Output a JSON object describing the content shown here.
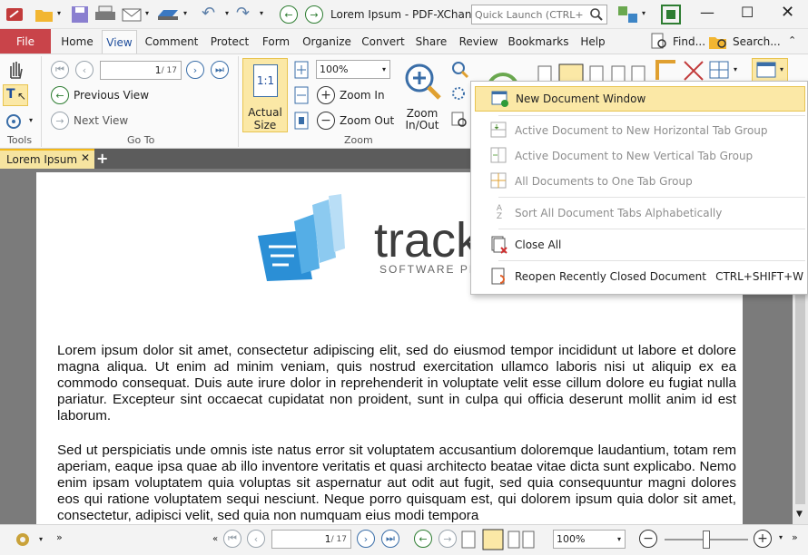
{
  "titlebar": {
    "doc_title": "Lorem Ipsum - PDF-XChan...",
    "quick_launch_placeholder": "Quick Launch (CTRL+.)"
  },
  "ribbon_tabs": [
    "File",
    "Home",
    "View",
    "Comment",
    "Protect",
    "Form",
    "Organize",
    "Convert",
    "Share",
    "Review",
    "Bookmarks",
    "Help"
  ],
  "ribbon_right": {
    "find": "Find...",
    "search": "Search..."
  },
  "ribbon": {
    "tools_label": "Tools",
    "goto_label": "Go To",
    "zoom_label": "Zoom",
    "page_field": "1",
    "page_total": "/ 17",
    "previous_view": "Previous View",
    "next_view": "Next View",
    "actual_size_line1": "Actual",
    "actual_size_line2": "Size",
    "actual_size_icon": "1:1",
    "zoom_value": "100%",
    "zoom_in": "Zoom In",
    "zoom_out": "Zoom Out",
    "zoom_inout_line1": "Zoom",
    "zoom_inout_line2": "In/Out"
  },
  "doc_tab": {
    "label": "Lorem Ipsum"
  },
  "document": {
    "logo_text": "track",
    "logo_sub": "SOFTWARE PRO",
    "para1": "Lorem ipsum dolor sit amet, consectetur adipiscing elit, sed do eiusmod tempor incididunt ut labore et dolore magna aliqua. Ut enim ad minim veniam, quis nostrud exercitation ullamco laboris nisi ut aliquip ex ea commodo consequat. Duis aute irure dolor in reprehenderit in voluptate velit esse cillum dolore eu fugiat nulla pariatur. Excepteur sint occaecat cupidatat non proident, sunt in culpa qui officia deserunt mollit anim id est laborum.",
    "para2": "Sed ut perspiciatis unde omnis iste natus error sit voluptatem accusantium doloremque laudantium, totam rem aperiam, eaque ipsa quae ab illo inventore veritatis et quasi architecto beatae vitae dicta sunt explicabo. Nemo enim ipsam voluptatem quia voluptas sit aspernatur aut odit aut fugit, sed quia consequuntur magni dolores eos qui ratione voluptatem sequi nesciunt. Neque porro quisquam est, qui dolorem ipsum quia dolor sit amet, consectetur, adipisci velit, sed quia non numquam eius modi tempora"
  },
  "menu": {
    "new_window": "New Document Window",
    "horizontal": "Active Document to New Horizontal Tab Group",
    "vertical": "Active Document to New Vertical Tab Group",
    "all_one": "All Documents to One Tab Group",
    "sort": "Sort All Document Tabs Alphabetically",
    "close_all": "Close All",
    "reopen": "Reopen Recently Closed Document",
    "reopen_shortcut": "CTRL+SHIFT+W"
  },
  "statusbar": {
    "page_field": "1",
    "page_total": "/ 17",
    "zoom_value": "100%"
  },
  "colors": {
    "file_tab": "#c9444a",
    "accent": "#f3b817",
    "menu_highlight": "#fbe8a6"
  }
}
